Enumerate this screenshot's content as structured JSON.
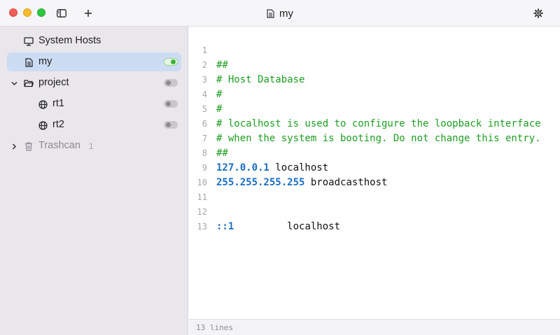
{
  "window": {
    "title": "my"
  },
  "sidebar": {
    "items": [
      {
        "label": "System Hosts"
      },
      {
        "label": "my",
        "enabled": true
      },
      {
        "label": "project",
        "enabled": false
      },
      {
        "label": "rt1",
        "enabled": false
      },
      {
        "label": "rt2",
        "enabled": false
      },
      {
        "label": "Trashcan",
        "count": "1"
      }
    ]
  },
  "editor": {
    "lines": [
      {
        "num": "1",
        "comment": "##"
      },
      {
        "num": "2",
        "comment": "# Host Database"
      },
      {
        "num": "3",
        "comment": "#"
      },
      {
        "num": "4",
        "comment": "#"
      },
      {
        "num": "5",
        "comment": "# localhost is used to configure the loopback interface"
      },
      {
        "num": "6",
        "comment": "# when the system is booting. Do not change this entry."
      },
      {
        "num": "7",
        "comment": "##"
      },
      {
        "num": "8",
        "ip": "127.0.0.1",
        "host": " localhost"
      },
      {
        "num": "9",
        "ip": "255.255.255.255",
        "host": " broadcasthost"
      },
      {
        "num": "10"
      },
      {
        "num": "11"
      },
      {
        "num": "12",
        "ip": "::1",
        "host": "         localhost"
      },
      {
        "num": "13"
      }
    ]
  },
  "status": {
    "lines": "13 lines"
  },
  "colors": {
    "comment": "#1f9d22",
    "ip": "#1a6ec1",
    "selection": "#ccdcf3",
    "toggle_on": "#3fb23c"
  }
}
